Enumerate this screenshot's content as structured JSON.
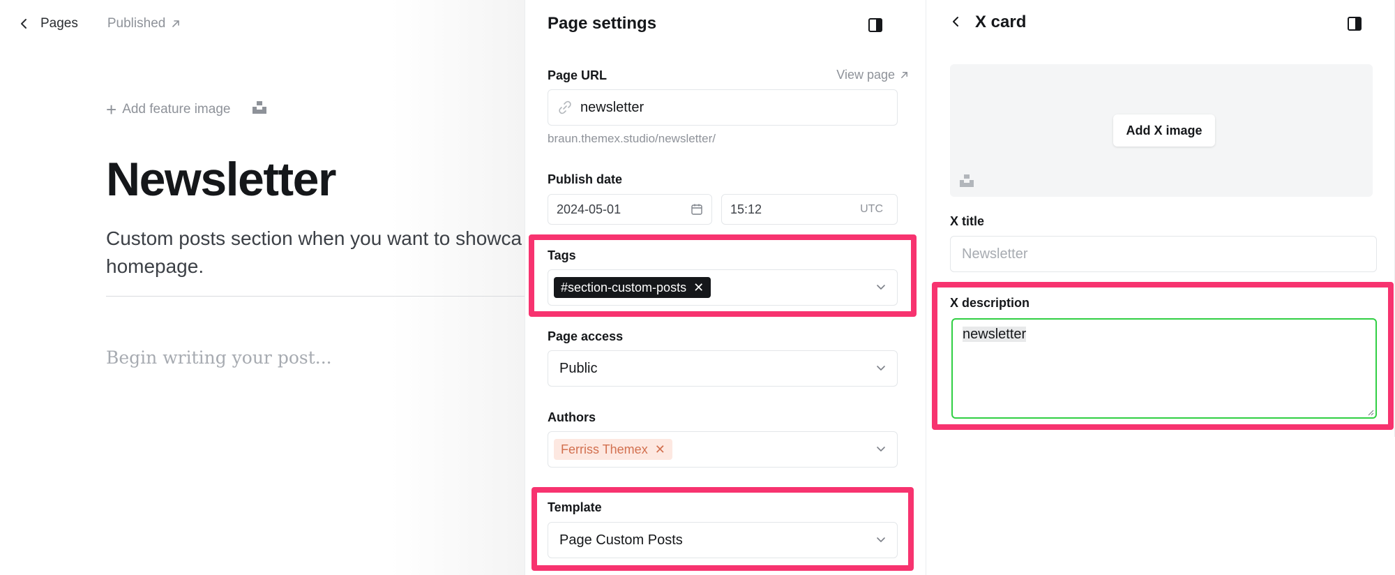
{
  "editor": {
    "back_label": "Pages",
    "status_label": "Published",
    "add_feature_image": "Add feature image",
    "title": "Newsletter",
    "excerpt": "Custom posts section when you want to showcase homepage.",
    "excerpt_line1": "Custom posts section when you want to showca",
    "excerpt_line2": "homepage.",
    "body_placeholder": "Begin writing your post..."
  },
  "settings": {
    "title": "Page settings",
    "page_url": {
      "label": "Page URL",
      "view_link": "View page",
      "value": "newsletter",
      "full_url": "braun.themex.studio/newsletter/"
    },
    "publish_date": {
      "label": "Publish date",
      "date": "2024-05-01",
      "time": "15:12",
      "timezone": "UTC"
    },
    "tags": {
      "label": "Tags",
      "items": [
        "#section-custom-posts"
      ]
    },
    "page_access": {
      "label": "Page access",
      "value": "Public"
    },
    "authors": {
      "label": "Authors",
      "items": [
        "Ferriss Themex"
      ]
    },
    "template": {
      "label": "Template",
      "value": "Page Custom Posts"
    }
  },
  "xcard": {
    "title": "X card",
    "add_image_label": "Add X image",
    "x_title": {
      "label": "X title",
      "placeholder": "Newsletter"
    },
    "x_description": {
      "label": "X description",
      "value": "newsletter"
    }
  },
  "colors": {
    "highlight": "#f7336f",
    "focus_border": "#30cf43",
    "tag_chip_bg": "#15171a",
    "author_chip_bg": "#fde8e1",
    "author_chip_text": "#d2704f"
  }
}
